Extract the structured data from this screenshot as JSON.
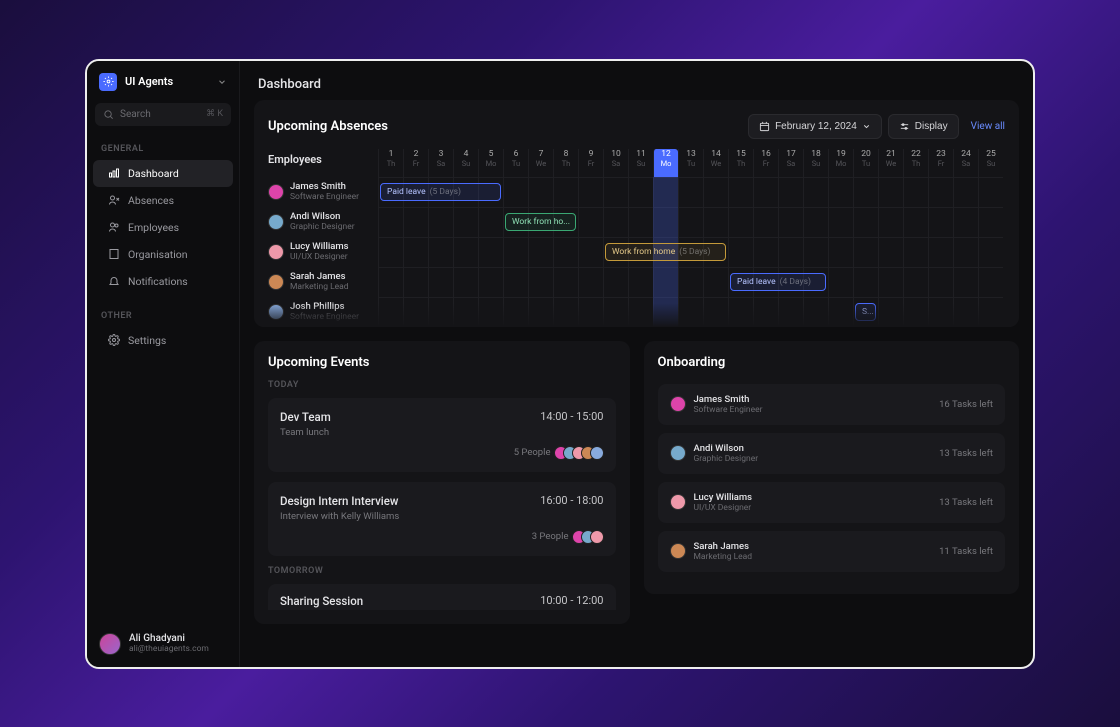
{
  "brand": {
    "name": "UI Agents"
  },
  "search": {
    "placeholder": "Search",
    "shortcut": "⌘ K"
  },
  "nav": {
    "general_label": "GENERAL",
    "other_label": "OTHER",
    "items": [
      {
        "label": "Dashboard"
      },
      {
        "label": "Absences"
      },
      {
        "label": "Employees"
      },
      {
        "label": "Organisation"
      },
      {
        "label": "Notifications"
      }
    ],
    "other": [
      {
        "label": "Settings"
      }
    ]
  },
  "user": {
    "name": "Ali Ghadyani",
    "email": "ali@theuiagents.com"
  },
  "page": {
    "title": "Dashboard"
  },
  "absences": {
    "title": "Upcoming Absences",
    "date_label": "February 12, 2024",
    "display_label": "Display",
    "view_all": "View all",
    "employees_header": "Employees",
    "days": [
      {
        "n": "1",
        "d": "Th"
      },
      {
        "n": "2",
        "d": "Fr"
      },
      {
        "n": "3",
        "d": "Sa"
      },
      {
        "n": "4",
        "d": "Su"
      },
      {
        "n": "5",
        "d": "Mo"
      },
      {
        "n": "6",
        "d": "Tu"
      },
      {
        "n": "7",
        "d": "We"
      },
      {
        "n": "8",
        "d": "Th"
      },
      {
        "n": "9",
        "d": "Fr"
      },
      {
        "n": "10",
        "d": "Sa"
      },
      {
        "n": "11",
        "d": "Su"
      },
      {
        "n": "12",
        "d": "Mo",
        "today": true
      },
      {
        "n": "13",
        "d": "Tu"
      },
      {
        "n": "14",
        "d": "We"
      },
      {
        "n": "15",
        "d": "Th"
      },
      {
        "n": "16",
        "d": "Fr"
      },
      {
        "n": "17",
        "d": "Sa"
      },
      {
        "n": "18",
        "d": "Su"
      },
      {
        "n": "19",
        "d": "Mo"
      },
      {
        "n": "20",
        "d": "Tu"
      },
      {
        "n": "21",
        "d": "We"
      },
      {
        "n": "22",
        "d": "Th"
      },
      {
        "n": "23",
        "d": "Fr"
      },
      {
        "n": "24",
        "d": "Sa"
      },
      {
        "n": "25",
        "d": "Su"
      }
    ],
    "employees": [
      {
        "name": "James Smith",
        "role": "Software Engineer"
      },
      {
        "name": "Andi Wilson",
        "role": "Graphic Designer"
      },
      {
        "name": "Lucy Williams",
        "role": "UI/UX Designer"
      },
      {
        "name": "Sarah James",
        "role": "Marketing Lead"
      },
      {
        "name": "Josh Phillips",
        "role": "Software Engineer"
      }
    ],
    "entries": [
      {
        "row": 0,
        "type": "paid",
        "label": "Paid leave",
        "days": "(5 Days)",
        "start": 0,
        "span": 5
      },
      {
        "row": 1,
        "type": "wfh",
        "label": "Work from ho...",
        "days": "",
        "start": 5,
        "span": 3
      },
      {
        "row": 2,
        "type": "sick",
        "label": "Work from home",
        "days": "(5 Days)",
        "start": 9,
        "span": 5
      },
      {
        "row": 3,
        "type": "paid",
        "label": "Paid leave",
        "days": "(4 Days)",
        "start": 14,
        "span": 4
      },
      {
        "row": 4,
        "type": "paid",
        "label": "S...",
        "days": "",
        "start": 19,
        "span": 1
      }
    ]
  },
  "events": {
    "title": "Upcoming Events",
    "today_label": "TODAY",
    "tomorrow_label": "TOMORROW",
    "today": [
      {
        "title": "Dev Team",
        "time": "14:00 - 15:00",
        "desc": "Team lunch",
        "people": "5 People"
      },
      {
        "title": "Design Intern Interview",
        "time": "16:00 - 18:00",
        "desc": "Interview with Kelly Williams",
        "people": "3 People"
      }
    ],
    "tomorrow": [
      {
        "title": "Sharing Session",
        "time": "10:00 - 12:00"
      }
    ]
  },
  "onboarding": {
    "title": "Onboarding",
    "people": [
      {
        "name": "James Smith",
        "role": "Software Engineer",
        "tasks": "16 Tasks left"
      },
      {
        "name": "Andi Wilson",
        "role": "Graphic Designer",
        "tasks": "13 Tasks left"
      },
      {
        "name": "Lucy Williams",
        "role": "UI/UX Designer",
        "tasks": "13 Tasks left"
      },
      {
        "name": "Sarah James",
        "role": "Marketing Lead",
        "tasks": "11 Tasks left"
      }
    ]
  }
}
